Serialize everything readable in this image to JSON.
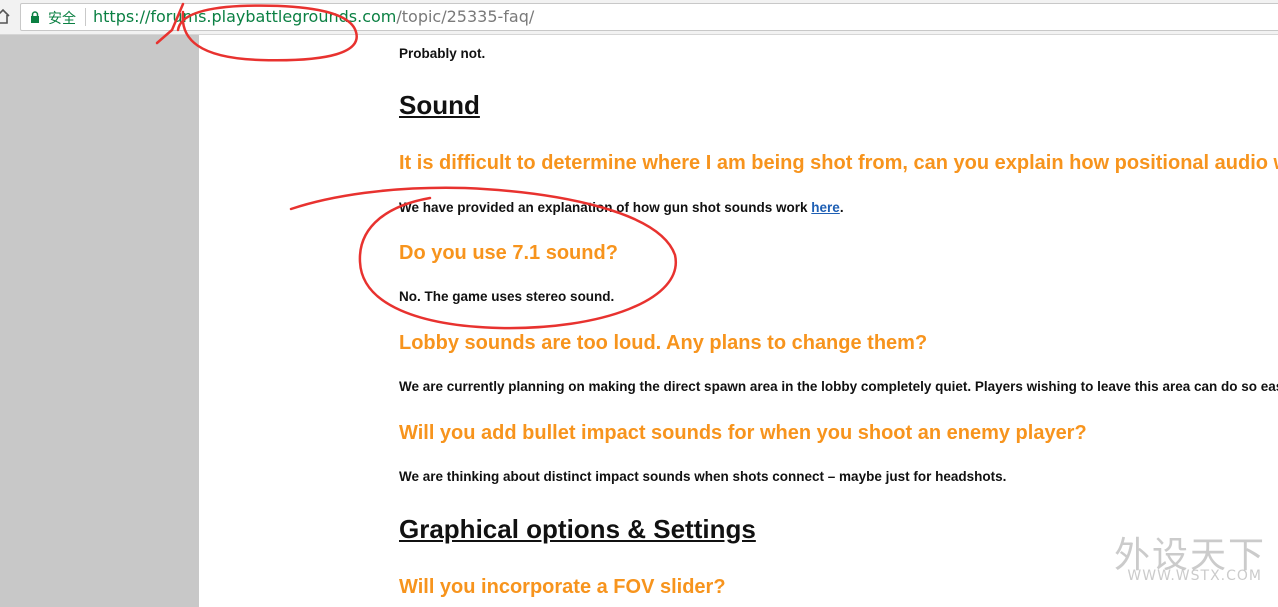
{
  "browser": {
    "secure_label": "安全",
    "url_host": "https://forums.playbattlegrounds.com",
    "url_path": "/topic/25335-faq/"
  },
  "article": {
    "probably_not": "Probably not.",
    "sound_heading": "Sound",
    "q1": "It is difficult to determine where I am being shot from, can you explain how positional audio w",
    "a1_pre": "We have provided an explanation of how gun shot sounds work ",
    "a1_link": "here",
    "a1_post": ".",
    "q2": "Do you use 7.1 sound?",
    "a2": "No. The game uses stereo sound.",
    "q3": "Lobby sounds are too loud. Any plans to change them?",
    "a3": "We are currently planning on making the direct spawn area in the lobby completely quiet. Players wishing to leave this area can do so easily.",
    "q4": "Will you add bullet impact sounds for when you shoot an enemy player?",
    "a4": "We are thinking about distinct impact sounds when shots connect – maybe just for headshots.",
    "graphics_heading": "Graphical options & Settings",
    "q5": "Will you incorporate a FOV slider?"
  },
  "watermark": {
    "cn": "外设天下",
    "en": "WWW.WSTX.COM"
  },
  "colors": {
    "question": "#f7941d",
    "link": "#1e5fb4",
    "annotation": "#e8322f",
    "secure": "#0b8043"
  }
}
